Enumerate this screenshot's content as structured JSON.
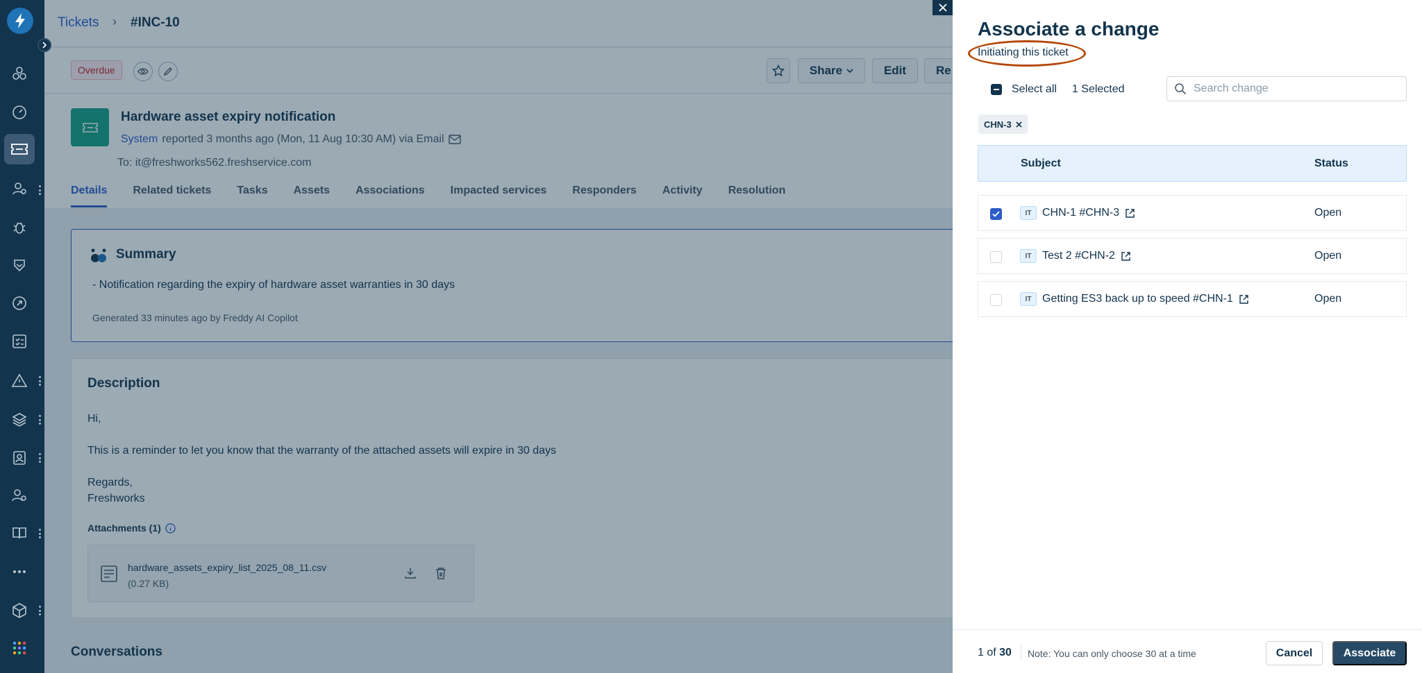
{
  "breadcrumb": {
    "parent": "Tickets",
    "separator": "›",
    "current": "#INC-10"
  },
  "actions": {
    "badge": "Overdue",
    "share_label": "Share",
    "edit_label": "Edit",
    "truncated_label": "Re"
  },
  "ticket": {
    "title": "Hardware asset expiry notification",
    "requester": "System",
    "reported": "reported 3 months ago (Mon, 11 Aug 10:30 AM) via Email",
    "to": "To:  it@freshworks562.freshservice.com"
  },
  "tabs": [
    "Details",
    "Related tickets",
    "Tasks",
    "Assets",
    "Associations",
    "Impacted services",
    "Responders",
    "Activity",
    "Resolution"
  ],
  "summary": {
    "title": "Summary",
    "body": "- Notification regarding the expiry of hardware asset warranties in 30 days",
    "generated": "Generated 33 minutes ago by Freddy AI Copilot"
  },
  "description": {
    "title": "Description",
    "greeting": "Hi,",
    "body": "This is a reminder to let you know that the warranty of the attached assets will expire in 30 days",
    "regards": "Regards,",
    "signature": "Freshworks",
    "attachments_label": "Attachments (1)",
    "file_name": "hardware_assets_expiry_list_2025_08_11.csv",
    "file_size": "(0.27 KB)"
  },
  "conversations_label": "Conversations",
  "drawer": {
    "title": "Associate a change",
    "subtitle": "Initiating this ticket",
    "select_all": "Select all",
    "selected_count": "1 Selected",
    "search_placeholder": "Search change",
    "chip": "CHN-3",
    "columns": {
      "subject": "Subject",
      "status": "Status"
    },
    "rows": [
      {
        "tag": "IT",
        "subject": "CHN-1 #CHN-3",
        "status": "Open",
        "checked": true
      },
      {
        "tag": "IT",
        "subject": "Test 2 #CHN-2",
        "status": "Open",
        "checked": false
      },
      {
        "tag": "IT",
        "subject": "Getting ES3 back up to speed #CHN-1",
        "status": "Open",
        "checked": false
      }
    ],
    "footer": {
      "page_current": "1",
      "page_of": "of",
      "page_total": "30",
      "note": "Note: You can only choose 30 at a time",
      "cancel": "Cancel",
      "associate": "Associate"
    }
  },
  "colors": {
    "rail": "#12344d",
    "accent": "#2c5cc5",
    "oval": "#b54708",
    "primary_button": "#264966"
  }
}
